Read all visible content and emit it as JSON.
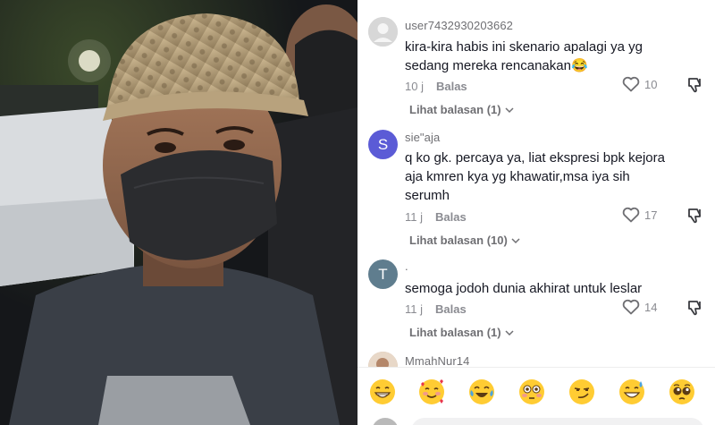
{
  "photo": {
    "description_icon": "person-photo"
  },
  "comments": [
    {
      "username": "user7432930203662",
      "avatar_initial": "",
      "avatar_color": "#d7d7d7",
      "text": "kira-kira habis ini skenario apalagi ya yg sedang mereka rencanakan😂",
      "time": "10 j",
      "reply_label": "Balas",
      "likes": "10",
      "view_replies": "Lihat balasan (1)"
    },
    {
      "username": "sie\"aja",
      "avatar_initial": "S",
      "avatar_color": "#5b5bd6",
      "text": "q ko gk. percaya ya, liat ekspresi bpk kejora aja kmren kya yg khawatir,msa iya sih serumh",
      "time": "11 j",
      "reply_label": "Balas",
      "likes": "17",
      "view_replies": "Lihat balasan (10)"
    },
    {
      "username": ".",
      "avatar_initial": "T",
      "avatar_color": "#5f7d8e",
      "text": "semoga jodoh dunia akhirat untuk leslar",
      "time": "11 j",
      "reply_label": "Balas",
      "likes": "14",
      "view_replies": "Lihat balasan (1)"
    },
    {
      "username": "MmahNur14",
      "avatar_color": "#c9a98f"
    }
  ],
  "emojis": [
    "😁",
    "🥰",
    "😂",
    "😳",
    "😏",
    "😅",
    "🥺"
  ],
  "colors": {
    "accent_text": "#161823",
    "muted": "#8a8b91"
  }
}
